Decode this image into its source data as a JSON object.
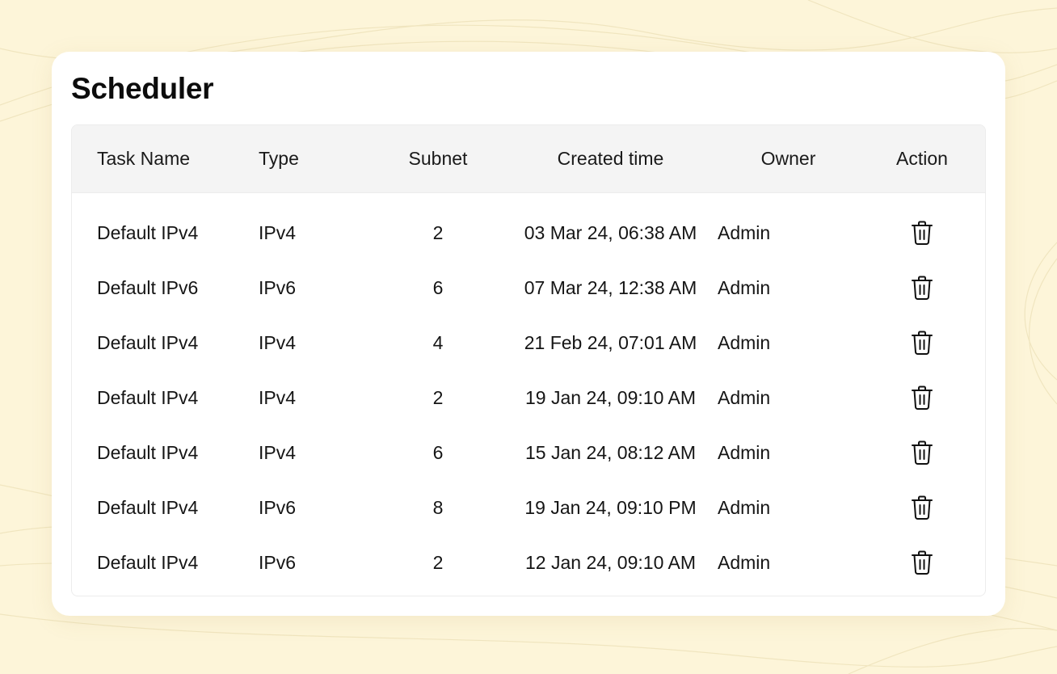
{
  "page": {
    "title": "Scheduler"
  },
  "table": {
    "columns": [
      "Task Name",
      "Type",
      "Subnet",
      "Created time",
      "Owner",
      "Action"
    ],
    "rows": [
      {
        "task_name": "Default IPv4",
        "type": "IPv4",
        "subnet": "2",
        "created": "03 Mar 24, 06:38 AM",
        "owner": "Admin",
        "action_icon": "trash-icon"
      },
      {
        "task_name": "Default IPv6",
        "type": "IPv6",
        "subnet": "6",
        "created": "07 Mar 24, 12:38 AM",
        "owner": "Admin",
        "action_icon": "trash-icon"
      },
      {
        "task_name": "Default IPv4",
        "type": "IPv4",
        "subnet": "4",
        "created": "21 Feb 24, 07:01 AM",
        "owner": "Admin",
        "action_icon": "trash-icon"
      },
      {
        "task_name": "Default IPv4",
        "type": "IPv4",
        "subnet": "2",
        "created": "19 Jan 24, 09:10 AM",
        "owner": "Admin",
        "action_icon": "trash-icon"
      },
      {
        "task_name": "Default IPv4",
        "type": "IPv4",
        "subnet": "6",
        "created": "15 Jan 24, 08:12 AM",
        "owner": "Admin",
        "action_icon": "trash-icon"
      },
      {
        "task_name": "Default IPv4",
        "type": "IPv6",
        "subnet": "8",
        "created": "19 Jan 24, 09:10 PM",
        "owner": "Admin",
        "action_icon": "trash-icon"
      },
      {
        "task_name": "Default IPv4",
        "type": "IPv6",
        "subnet": "2",
        "created": "12 Jan 24, 09:10 AM",
        "owner": "Admin",
        "action_icon": "trash-icon"
      }
    ]
  },
  "colors": {
    "background": "#fdf5d9",
    "card": "#ffffff",
    "header_bg": "#f4f4f4",
    "text": "#111111"
  }
}
